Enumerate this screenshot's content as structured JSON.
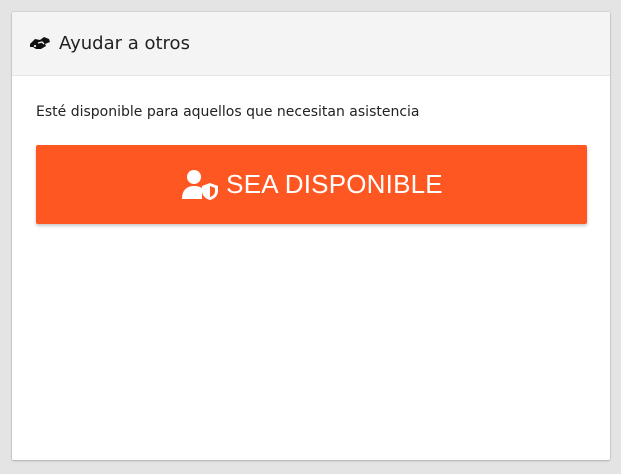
{
  "panel": {
    "title": "Ayudar a otros",
    "header_icon": "helping-hands-icon",
    "description": "Esté disponible para aquellos que necesitan asistencia"
  },
  "button": {
    "label": "SEA DISPONIBLE",
    "icon": "user-shield-icon",
    "color": "#ff5722"
  },
  "colors": {
    "header_bg": "#f4f4f4",
    "text": "#222222",
    "button_text": "#ffffff"
  }
}
